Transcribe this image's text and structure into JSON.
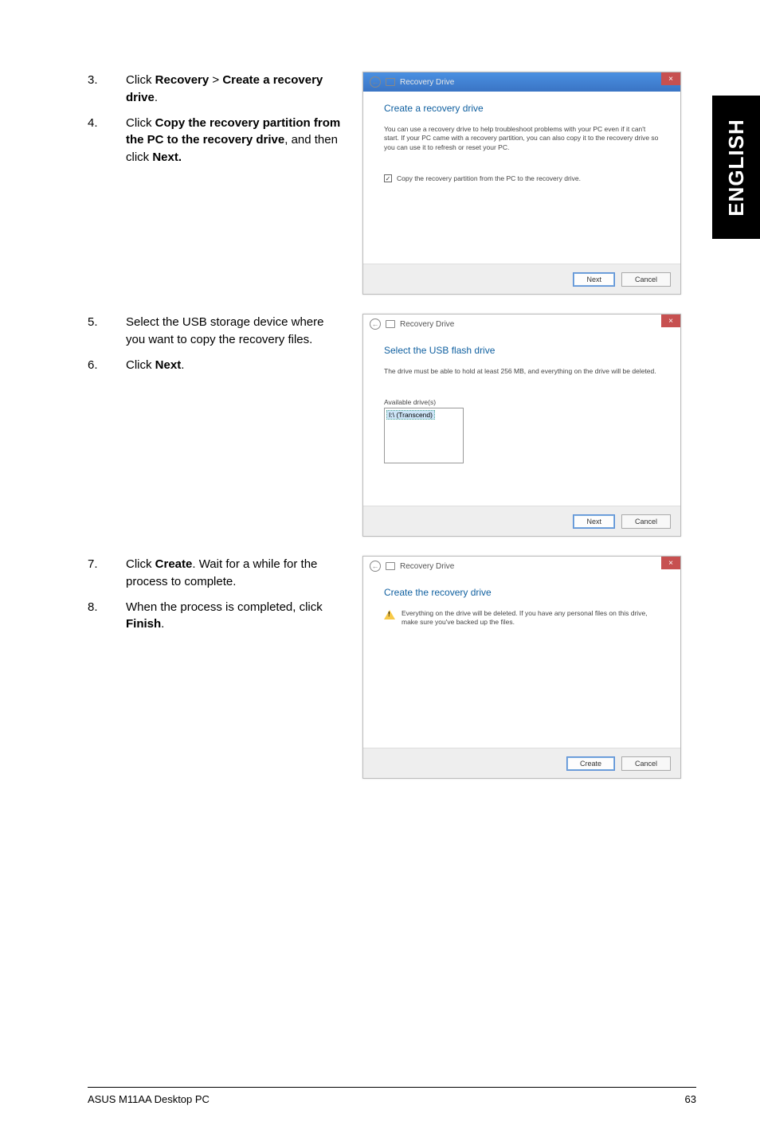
{
  "sideTab": "ENGLISH",
  "steps": {
    "s3": {
      "num": "3.",
      "pre": "Click ",
      "b1": "Recovery",
      "mid": " > ",
      "b2": "Create a recovery drive",
      "post": "."
    },
    "s4": {
      "num": "4.",
      "pre": "Click ",
      "b1": "Copy the recovery partition from the PC to the recovery drive",
      "mid": ", and then click ",
      "b2": "Next."
    },
    "s5": {
      "num": "5.",
      "text": "Select the USB storage device where you want to copy the recovery files."
    },
    "s6": {
      "num": "6.",
      "pre": "Click ",
      "b1": "Next",
      "post": "."
    },
    "s7": {
      "num": "7.",
      "pre": "Click ",
      "b1": "Create",
      "post": ". Wait for a while for the process to complete."
    },
    "s8": {
      "num": "8.",
      "pre": "When the process is completed, click ",
      "b1": "Finish",
      "post": "."
    }
  },
  "dialog1": {
    "title": "Recovery Drive",
    "heading": "Create a recovery drive",
    "desc": "You can use a recovery drive to help troubleshoot problems with your PC even if it can't start. If your PC came with a recovery partition, you can also copy it to the recovery drive so you can use it to refresh or reset your PC.",
    "checkboxLabel": "Copy the recovery partition from the PC to the recovery drive.",
    "next": "Next",
    "cancel": "Cancel"
  },
  "dialog2": {
    "title": "Recovery Drive",
    "heading": "Select the USB flash drive",
    "desc": "The drive must be able to hold at least 256 MB, and everything on the drive will be deleted.",
    "listLabel": "Available drive(s)",
    "listItem": "I:\\ (Transcend)",
    "next": "Next",
    "cancel": "Cancel"
  },
  "dialog3": {
    "title": "Recovery Drive",
    "heading": "Create the recovery drive",
    "warn": "Everything on the drive will be deleted. If you have any personal files on this drive, make sure you've backed up the files.",
    "create": "Create",
    "cancel": "Cancel"
  },
  "footer": {
    "product": "ASUS M11AA Desktop PC",
    "page": "63"
  }
}
